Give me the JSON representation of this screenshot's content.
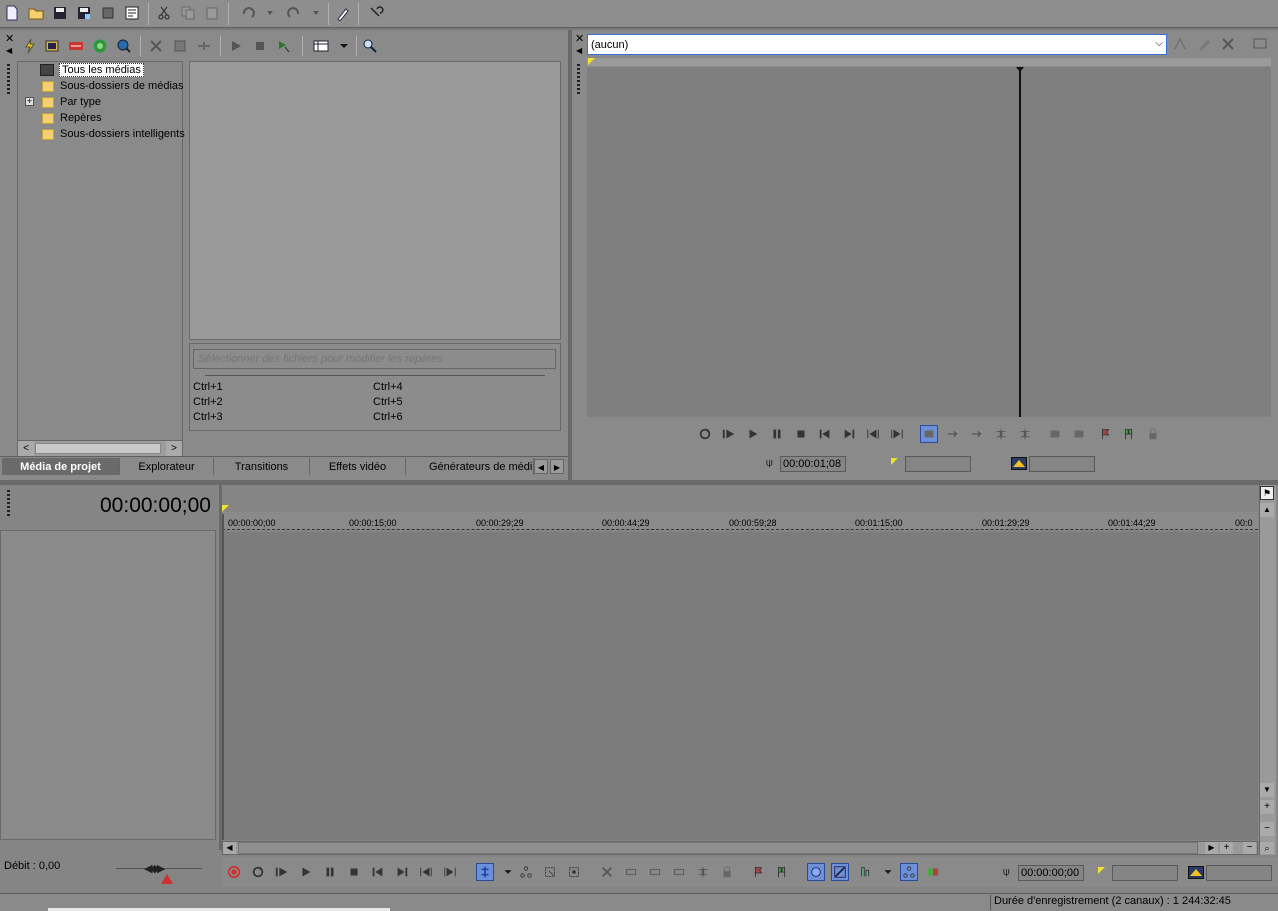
{
  "app": {
    "toolbar": [
      "new-icon",
      "open-icon",
      "save-icon",
      "save-as-icon",
      "render-icon",
      "properties-icon",
      "cut-icon",
      "copy-icon",
      "paste-icon",
      "undo-icon",
      "redo-icon",
      "edit-tool-icon",
      "help-icon"
    ]
  },
  "media_panel": {
    "tree": [
      {
        "label": "Tous les médias",
        "icon": "all-media-icon"
      },
      {
        "label": "Sous-dossiers de médias",
        "icon": "folder-icon"
      },
      {
        "label": "Par type",
        "icon": "folder-icon"
      },
      {
        "label": "Repères",
        "icon": "folder-icon"
      },
      {
        "label": "Sous-dossiers intelligents",
        "icon": "folder-icon"
      }
    ],
    "tags_placeholder": "Sélectionner des fichiers pour modifier les repères",
    "shortcuts": [
      [
        "Ctrl+1",
        "Ctrl+4"
      ],
      [
        "Ctrl+2",
        "Ctrl+5"
      ],
      [
        "Ctrl+3",
        "Ctrl+6"
      ]
    ],
    "tabs": [
      "Média de projet",
      "Explorateur",
      "Transitions",
      "Effets vidéo",
      "Générateurs de médi"
    ]
  },
  "trimmer": {
    "selected": "(aucun)",
    "time": "00:00:01;08"
  },
  "timeline": {
    "time": "00:00:00;00",
    "ruler": [
      "00:00:00;00",
      "00:00:15;00",
      "00:00:29;29",
      "00:00:44;29",
      "00:00:59;28",
      "00:01:15;00",
      "00:01:29;29",
      "00:01:44;29",
      "00:0"
    ],
    "rate": "Débit : 0,00",
    "cursor_time": "00:00:00;00",
    "status": "Durée d'enregistrement (2 canaux) : 1 244:32:45"
  },
  "colors": {
    "accent": "#3a6fd8",
    "marker": "#f0e030",
    "record": "#d03030"
  }
}
